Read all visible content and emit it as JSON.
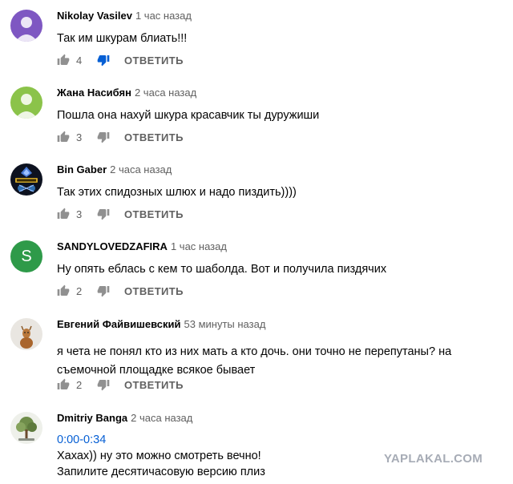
{
  "reply_label": "ОТВЕТИТЬ",
  "colors": {
    "like_gray": "#909090",
    "dislike_active": "#065fd4",
    "link_blue": "#065fd4",
    "avatar_s": "#2e9a49"
  },
  "comments": [
    {
      "author": "Nikolay Vasilev",
      "time": "1 час назад",
      "text": [
        "Так им шкурам блиать!!!"
      ],
      "likes": "4",
      "dislike_active": true,
      "avatar": "default-purple-avatar"
    },
    {
      "author": "Жана Насибян",
      "time": "2 часа назад",
      "text": [
        "Пошла она нахуй шкура красавчик ты дуружиши"
      ],
      "likes": "3",
      "dislike_active": false,
      "avatar": "default-green-avatar"
    },
    {
      "author": "Bin Gaber",
      "time": "2 часа назад",
      "text": [
        "Так этих спидозных шлюх и надо пиздить))))"
      ],
      "likes": "3",
      "dislike_active": false,
      "avatar": "mining-life-logo-avatar"
    },
    {
      "author": "SANDYLOVEDZAFIRA",
      "time": "1 час назад",
      "text": [
        "Ну опять еблась с кем то шаболда. Вот и получила пиздячих"
      ],
      "likes": "2",
      "dislike_active": false,
      "avatar": "letter-avatar",
      "avatar_letter": "S"
    },
    {
      "author": "Евгений Файвишевский",
      "time": "53 минуты назад",
      "text": [
        "я чета не понял кто из них мать а кто дочь. они точно не перепутаны? на",
        "съемочной площадке всякое бывает"
      ],
      "likes": "2",
      "dislike_active": false,
      "avatar": "deer-photo-avatar"
    },
    {
      "author": "Dmitriy Banga",
      "time": "2 часа назад",
      "timestamp_link": "0:00-0:34",
      "text": [
        "Хахах))  ну это можно смотреть вечно!",
        "Запилите десятичасовую версию плиз"
      ],
      "avatar": "tree-photo-avatar"
    }
  ],
  "watermark": "YAPLAKAL.COM"
}
